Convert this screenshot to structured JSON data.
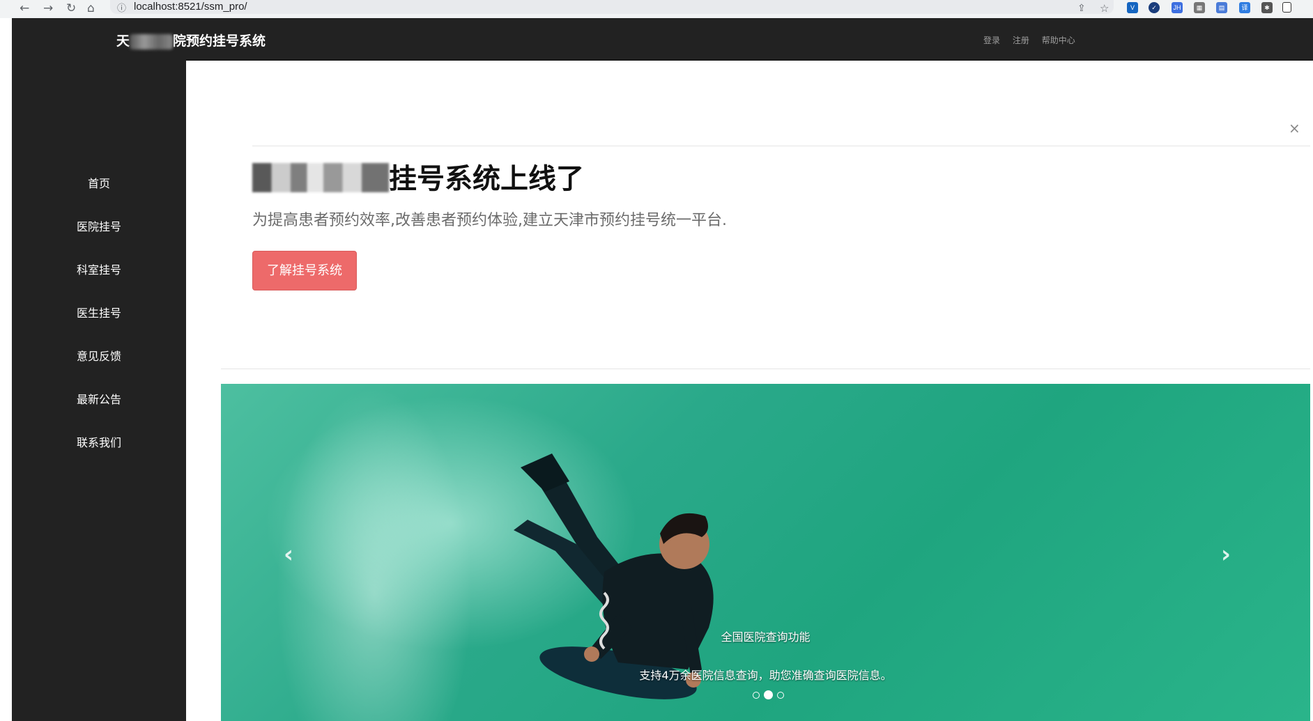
{
  "browser": {
    "url": "localhost:8521/ssm_pro/"
  },
  "brand": {
    "prefix": "天",
    "suffix": "院预约挂号系统"
  },
  "topnav": {
    "links": [
      "登录",
      "注册",
      "帮助中心"
    ]
  },
  "sidebar": {
    "items": [
      "首页",
      "医院挂号",
      "科室挂号",
      "医生挂号",
      "意见反馈",
      "最新公告",
      "联系我们"
    ]
  },
  "hero": {
    "close": "×",
    "headline_visible": "挂号系统上线了",
    "headline_fragment": "医院",
    "subtitle": "为提高患者预约效率,改善患者预约体验,建立天津市预约挂号统一平台.",
    "button": "了解挂号系统"
  },
  "carousel": {
    "caption_title": "全国医院查询功能",
    "caption_text": "支持4万余医院信息查询，助您准确查询医院信息。",
    "prev": "‹",
    "next": "›",
    "slide_count": 3,
    "active_index": 1
  },
  "colors": {
    "nav_bg": "#222222",
    "cta_bg": "#ed6a6a",
    "carousel_sea": "#2aa98a"
  }
}
